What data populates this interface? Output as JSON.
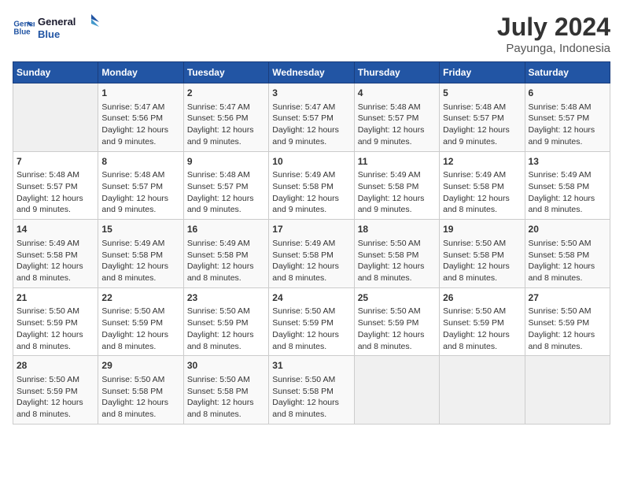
{
  "logo": {
    "line1": "General",
    "line2": "Blue"
  },
  "title": {
    "month_year": "July 2024",
    "location": "Payunga, Indonesia"
  },
  "headers": [
    "Sunday",
    "Monday",
    "Tuesday",
    "Wednesday",
    "Thursday",
    "Friday",
    "Saturday"
  ],
  "weeks": [
    [
      {
        "day": "",
        "info": ""
      },
      {
        "day": "1",
        "info": "Sunrise: 5:47 AM\nSunset: 5:56 PM\nDaylight: 12 hours\nand 9 minutes."
      },
      {
        "day": "2",
        "info": "Sunrise: 5:47 AM\nSunset: 5:56 PM\nDaylight: 12 hours\nand 9 minutes."
      },
      {
        "day": "3",
        "info": "Sunrise: 5:47 AM\nSunset: 5:57 PM\nDaylight: 12 hours\nand 9 minutes."
      },
      {
        "day": "4",
        "info": "Sunrise: 5:48 AM\nSunset: 5:57 PM\nDaylight: 12 hours\nand 9 minutes."
      },
      {
        "day": "5",
        "info": "Sunrise: 5:48 AM\nSunset: 5:57 PM\nDaylight: 12 hours\nand 9 minutes."
      },
      {
        "day": "6",
        "info": "Sunrise: 5:48 AM\nSunset: 5:57 PM\nDaylight: 12 hours\nand 9 minutes."
      }
    ],
    [
      {
        "day": "7",
        "info": "Sunrise: 5:48 AM\nSunset: 5:57 PM\nDaylight: 12 hours\nand 9 minutes."
      },
      {
        "day": "8",
        "info": "Sunrise: 5:48 AM\nSunset: 5:57 PM\nDaylight: 12 hours\nand 9 minutes."
      },
      {
        "day": "9",
        "info": "Sunrise: 5:48 AM\nSunset: 5:57 PM\nDaylight: 12 hours\nand 9 minutes."
      },
      {
        "day": "10",
        "info": "Sunrise: 5:49 AM\nSunset: 5:58 PM\nDaylight: 12 hours\nand 9 minutes."
      },
      {
        "day": "11",
        "info": "Sunrise: 5:49 AM\nSunset: 5:58 PM\nDaylight: 12 hours\nand 9 minutes."
      },
      {
        "day": "12",
        "info": "Sunrise: 5:49 AM\nSunset: 5:58 PM\nDaylight: 12 hours\nand 8 minutes."
      },
      {
        "day": "13",
        "info": "Sunrise: 5:49 AM\nSunset: 5:58 PM\nDaylight: 12 hours\nand 8 minutes."
      }
    ],
    [
      {
        "day": "14",
        "info": "Sunrise: 5:49 AM\nSunset: 5:58 PM\nDaylight: 12 hours\nand 8 minutes."
      },
      {
        "day": "15",
        "info": "Sunrise: 5:49 AM\nSunset: 5:58 PM\nDaylight: 12 hours\nand 8 minutes."
      },
      {
        "day": "16",
        "info": "Sunrise: 5:49 AM\nSunset: 5:58 PM\nDaylight: 12 hours\nand 8 minutes."
      },
      {
        "day": "17",
        "info": "Sunrise: 5:49 AM\nSunset: 5:58 PM\nDaylight: 12 hours\nand 8 minutes."
      },
      {
        "day": "18",
        "info": "Sunrise: 5:50 AM\nSunset: 5:58 PM\nDaylight: 12 hours\nand 8 minutes."
      },
      {
        "day": "19",
        "info": "Sunrise: 5:50 AM\nSunset: 5:58 PM\nDaylight: 12 hours\nand 8 minutes."
      },
      {
        "day": "20",
        "info": "Sunrise: 5:50 AM\nSunset: 5:58 PM\nDaylight: 12 hours\nand 8 minutes."
      }
    ],
    [
      {
        "day": "21",
        "info": "Sunrise: 5:50 AM\nSunset: 5:59 PM\nDaylight: 12 hours\nand 8 minutes."
      },
      {
        "day": "22",
        "info": "Sunrise: 5:50 AM\nSunset: 5:59 PM\nDaylight: 12 hours\nand 8 minutes."
      },
      {
        "day": "23",
        "info": "Sunrise: 5:50 AM\nSunset: 5:59 PM\nDaylight: 12 hours\nand 8 minutes."
      },
      {
        "day": "24",
        "info": "Sunrise: 5:50 AM\nSunset: 5:59 PM\nDaylight: 12 hours\nand 8 minutes."
      },
      {
        "day": "25",
        "info": "Sunrise: 5:50 AM\nSunset: 5:59 PM\nDaylight: 12 hours\nand 8 minutes."
      },
      {
        "day": "26",
        "info": "Sunrise: 5:50 AM\nSunset: 5:59 PM\nDaylight: 12 hours\nand 8 minutes."
      },
      {
        "day": "27",
        "info": "Sunrise: 5:50 AM\nSunset: 5:59 PM\nDaylight: 12 hours\nand 8 minutes."
      }
    ],
    [
      {
        "day": "28",
        "info": "Sunrise: 5:50 AM\nSunset: 5:59 PM\nDaylight: 12 hours\nand 8 minutes."
      },
      {
        "day": "29",
        "info": "Sunrise: 5:50 AM\nSunset: 5:58 PM\nDaylight: 12 hours\nand 8 minutes."
      },
      {
        "day": "30",
        "info": "Sunrise: 5:50 AM\nSunset: 5:58 PM\nDaylight: 12 hours\nand 8 minutes."
      },
      {
        "day": "31",
        "info": "Sunrise: 5:50 AM\nSunset: 5:58 PM\nDaylight: 12 hours\nand 8 minutes."
      },
      {
        "day": "",
        "info": ""
      },
      {
        "day": "",
        "info": ""
      },
      {
        "day": "",
        "info": ""
      }
    ]
  ]
}
